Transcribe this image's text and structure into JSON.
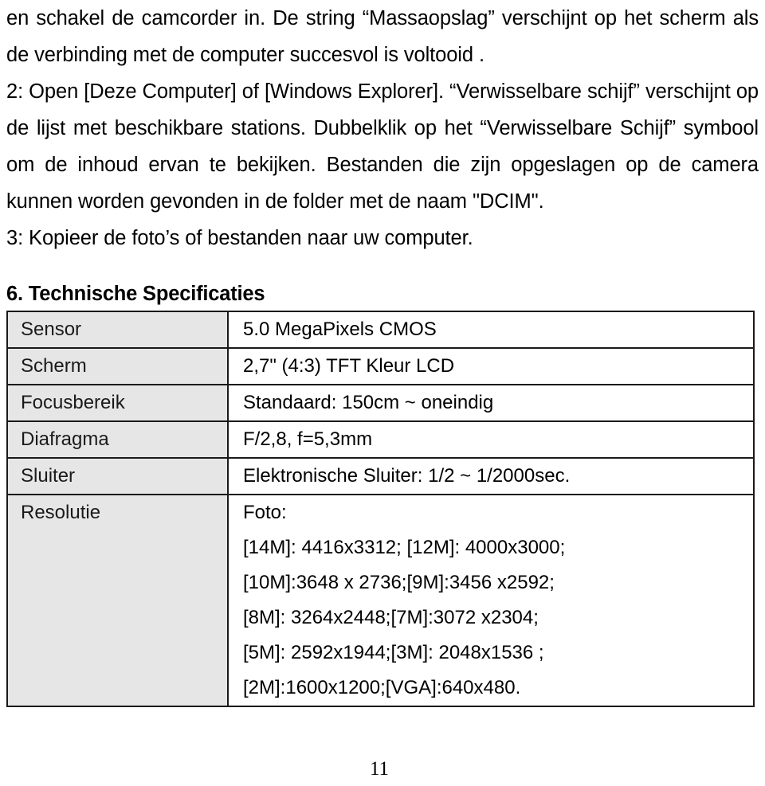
{
  "document": {
    "page_number": "11",
    "paragraphs": [
      "en schakel de camcorder in. De string “Massaopslag” verschijnt op het scherm als de verbinding met de computer succesvol is voltooid .",
      "2: Open [Deze Computer] of [Windows Explorer]. “Verwisselbare schijf” verschijnt op de lijst met beschikbare stations. Dubbelklik op het “Verwisselbare Schijf” symbool om de inhoud ervan te bekijken. Bestanden die zijn opgeslagen op de camera kunnen worden gevonden in de folder met de naam \"DCIM\".",
      "3: Kopieer de foto’s of bestanden naar uw computer."
    ],
    "section": {
      "heading": "6. Technische Specificaties",
      "table": {
        "rows": [
          {
            "label": "Sensor",
            "value": "5.0 MegaPixels CMOS"
          },
          {
            "label": "Scherm",
            "value": "2,7\" (4:3) TFT Kleur LCD"
          },
          {
            "label": "Focusbereik",
            "value": "Standaard: 150cm ~ oneindig"
          },
          {
            "label": "Diafragma",
            "value": "F/2,8, f=5,3mm"
          },
          {
            "label": "Sluiter",
            "value": "Elektronische Sluiter: 1/2 ~ 1/2000sec."
          }
        ],
        "resolution_row": {
          "label": "Resolutie",
          "lines": [
            "Foto:",
            "[14M]: 4416x3312; [12M]: 4000x3000;",
            "[10M]:3648 x 2736;[9M]:3456 x2592;",
            "[8M]: 3264x2448;[7M]:3072 x2304;",
            "[5M]: 2592x1944;[3M]: 2048x1536 ;",
            "[2M]:1600x1200;[VGA]:640x480."
          ]
        }
      }
    },
    "colors": {
      "label_cell_background": "#e6e6e6",
      "border": "#1a1a1a",
      "text": "#000000"
    }
  }
}
